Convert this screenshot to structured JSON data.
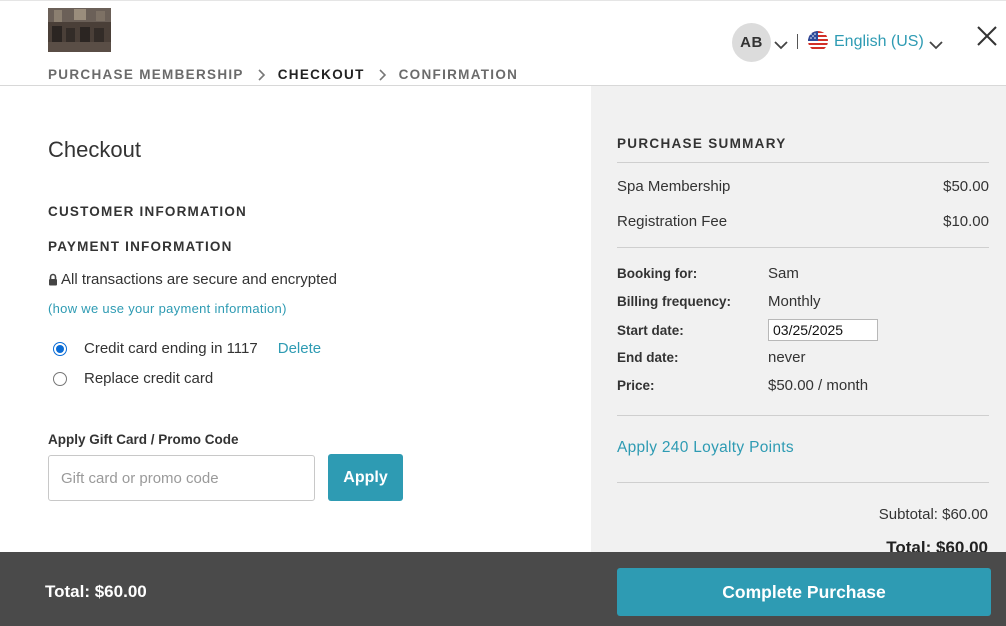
{
  "breadcrumb": [
    "PURCHASE MEMBERSHIP",
    "CHECKOUT",
    "CONFIRMATION"
  ],
  "header": {
    "avatar_initials": "AB",
    "language": "English (US)",
    "icons": [
      "chevron-down-icon",
      "us-flag-icon",
      "close-icon"
    ]
  },
  "checkout": {
    "title": "Checkout",
    "customer_info_heading": "CUSTOMER INFORMATION",
    "payment_info_heading": "PAYMENT INFORMATION",
    "secure_text": "All transactions are secure and encrypted",
    "payment_info_link": "(how we use your payment information)",
    "card_options": [
      {
        "label": "Credit card ending in 1117",
        "checked": true,
        "action": "Delete"
      },
      {
        "label": "Replace credit card",
        "checked": false
      }
    ],
    "promo": {
      "label": "Apply Gift Card / Promo Code",
      "placeholder": "Gift card or promo code",
      "value": "",
      "button": "Apply"
    }
  },
  "summary": {
    "heading": "PURCHASE SUMMARY",
    "items": [
      {
        "name": "Spa Membership",
        "price": "$50.00"
      },
      {
        "name": "Registration Fee",
        "price": "$10.00"
      }
    ],
    "details": {
      "booking_for_label": "Booking for:",
      "booking_for": "Sam",
      "billing_frequency_label": "Billing frequency:",
      "billing_frequency": "Monthly",
      "start_date_label": "Start date:",
      "start_date": "03/25/2025",
      "end_date_label": "End date:",
      "end_date": "never",
      "price_label": "Price:",
      "price": "$50.00 / month"
    },
    "loyalty_link": "Apply 240 Loyalty Points",
    "subtotal": "Subtotal: $60.00",
    "total": "Total: $60.00"
  },
  "footer": {
    "total": "Total: $60.00",
    "complete_button": "Complete Purchase"
  },
  "colors": {
    "accent": "#2e9bb3",
    "footer_bg": "#4a4a4a",
    "summary_bg": "#f1f1f1",
    "radio_selected": "#0a6cd6"
  }
}
